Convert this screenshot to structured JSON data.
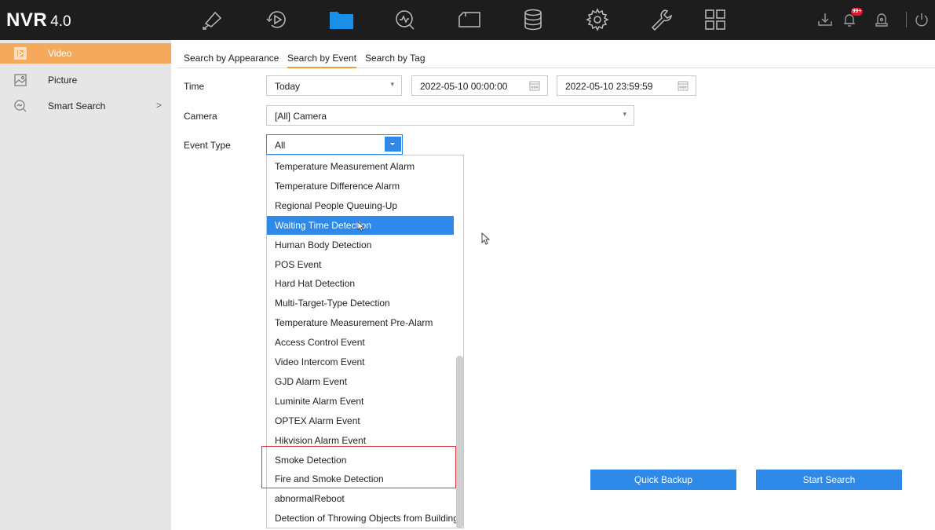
{
  "app": {
    "logo_main": "NVR",
    "logo_version": "4.0",
    "notification_badge": "99+"
  },
  "topnav": [
    {
      "name": "live-view-icon"
    },
    {
      "name": "playback-icon"
    },
    {
      "name": "file-management-icon"
    },
    {
      "name": "smart-analysis-icon"
    },
    {
      "name": "configuration-icon"
    },
    {
      "name": "storage-icon"
    },
    {
      "name": "settings-icon"
    },
    {
      "name": "maintenance-icon"
    },
    {
      "name": "apps-grid-icon"
    }
  ],
  "sidebar": {
    "items": [
      {
        "label": "Video",
        "active": true
      },
      {
        "label": "Picture"
      },
      {
        "label": "Smart Search",
        "arrow": ">"
      }
    ]
  },
  "tabs": [
    {
      "label": "Search by Appearance"
    },
    {
      "label": "Search by Event",
      "active": true
    },
    {
      "label": "Search by Tag"
    }
  ],
  "form": {
    "time_label": "Time",
    "time_value": "Today",
    "start_time": "2022-05-10 00:00:00",
    "end_time": "2022-05-10 23:59:59",
    "camera_label": "Camera",
    "camera_value": "[All] Camera",
    "event_type_label": "Event Type",
    "event_type_value": "All"
  },
  "event_options": [
    "Temperature Measurement Alarm",
    "Temperature Difference Alarm",
    "Regional People Queuing-Up",
    "Waiting Time Detection",
    "Human Body Detection",
    "POS Event",
    "Hard Hat Detection",
    "Multi-Target-Type Detection",
    "Temperature Measurement Pre-Alarm",
    "Access Control Event",
    "Video Intercom Event",
    "GJD Alarm Event",
    "Luminite Alarm Event",
    "OPTEX Alarm Event",
    "Hikvision Alarm Event",
    "Smoke Detection",
    "Fire and Smoke Detection",
    "abnormalReboot",
    "Detection of Throwing Objects from Building"
  ],
  "selected_option_index": 3,
  "buttons": {
    "quick_backup": "Quick Backup",
    "start_search": "Start Search"
  },
  "colors": {
    "accent": "#f5a95a",
    "primary": "#2e89e8",
    "highlight": "#e2343f",
    "topbar": "#1d1d1d"
  }
}
